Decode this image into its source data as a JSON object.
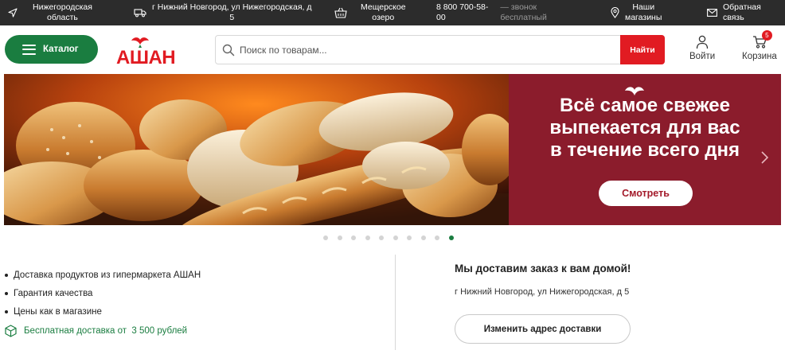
{
  "topbar": {
    "region": "Нижегородская\nобласть",
    "address": "г Нижний Новгород, ул Нижегородская, д\n5",
    "store": "Мещерское\nозеро",
    "phone": "8 800 700-58-\n00",
    "phone_note": "— звонок\nбесплатный",
    "stores": "Наши\nмагазины",
    "feedback": "Обратная\nсвязь"
  },
  "header": {
    "catalog_label": "Каталог",
    "logo_alt": "АШАН",
    "search_placeholder": "Поиск по товарам...",
    "search_button": "Найти",
    "login_label": "Войти",
    "cart_label": "Корзина",
    "cart_count": "5"
  },
  "banner": {
    "title": "Всё самое свежее\nвыпекается для вас\nв течение всего дня",
    "button": "Смотреть",
    "slides_total": 10,
    "active_slide": 10
  },
  "features": [
    "Доставка продуктов из гипермаркета АШАН",
    "Гарантия качества",
    "Цены как в магазине"
  ],
  "free_delivery": "Бесплатная доставка от  3 500 рублей",
  "delivery": {
    "title": "Мы доставим заказ к вам домой!",
    "address": "г Нижний Новгород, ул Нижегородская, д 5",
    "change_button": "Изменить адрес доставки"
  },
  "colors": {
    "brand_green": "#1a7d40",
    "brand_red": "#e11b22",
    "banner_red": "#8b1c2c",
    "topbar": "#2c2c2c"
  },
  "icons": [
    "location-arrow-icon",
    "truck-icon",
    "basket-icon",
    "map-pin-icon",
    "mail-icon",
    "menu-icon",
    "search-icon",
    "user-icon",
    "cart-icon",
    "chevron-right-icon",
    "delivery-box-icon"
  ]
}
